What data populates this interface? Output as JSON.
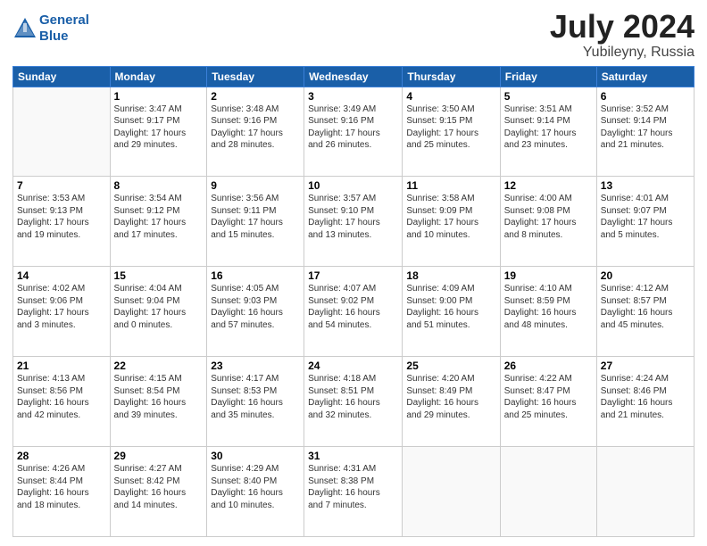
{
  "header": {
    "logo_line1": "General",
    "logo_line2": "Blue",
    "month": "July 2024",
    "location": "Yubileyny, Russia"
  },
  "weekdays": [
    "Sunday",
    "Monday",
    "Tuesday",
    "Wednesday",
    "Thursday",
    "Friday",
    "Saturday"
  ],
  "weeks": [
    [
      {
        "day": "",
        "info": ""
      },
      {
        "day": "1",
        "info": "Sunrise: 3:47 AM\nSunset: 9:17 PM\nDaylight: 17 hours\nand 29 minutes."
      },
      {
        "day": "2",
        "info": "Sunrise: 3:48 AM\nSunset: 9:16 PM\nDaylight: 17 hours\nand 28 minutes."
      },
      {
        "day": "3",
        "info": "Sunrise: 3:49 AM\nSunset: 9:16 PM\nDaylight: 17 hours\nand 26 minutes."
      },
      {
        "day": "4",
        "info": "Sunrise: 3:50 AM\nSunset: 9:15 PM\nDaylight: 17 hours\nand 25 minutes."
      },
      {
        "day": "5",
        "info": "Sunrise: 3:51 AM\nSunset: 9:14 PM\nDaylight: 17 hours\nand 23 minutes."
      },
      {
        "day": "6",
        "info": "Sunrise: 3:52 AM\nSunset: 9:14 PM\nDaylight: 17 hours\nand 21 minutes."
      }
    ],
    [
      {
        "day": "7",
        "info": "Sunrise: 3:53 AM\nSunset: 9:13 PM\nDaylight: 17 hours\nand 19 minutes."
      },
      {
        "day": "8",
        "info": "Sunrise: 3:54 AM\nSunset: 9:12 PM\nDaylight: 17 hours\nand 17 minutes."
      },
      {
        "day": "9",
        "info": "Sunrise: 3:56 AM\nSunset: 9:11 PM\nDaylight: 17 hours\nand 15 minutes."
      },
      {
        "day": "10",
        "info": "Sunrise: 3:57 AM\nSunset: 9:10 PM\nDaylight: 17 hours\nand 13 minutes."
      },
      {
        "day": "11",
        "info": "Sunrise: 3:58 AM\nSunset: 9:09 PM\nDaylight: 17 hours\nand 10 minutes."
      },
      {
        "day": "12",
        "info": "Sunrise: 4:00 AM\nSunset: 9:08 PM\nDaylight: 17 hours\nand 8 minutes."
      },
      {
        "day": "13",
        "info": "Sunrise: 4:01 AM\nSunset: 9:07 PM\nDaylight: 17 hours\nand 5 minutes."
      }
    ],
    [
      {
        "day": "14",
        "info": "Sunrise: 4:02 AM\nSunset: 9:06 PM\nDaylight: 17 hours\nand 3 minutes."
      },
      {
        "day": "15",
        "info": "Sunrise: 4:04 AM\nSunset: 9:04 PM\nDaylight: 17 hours\nand 0 minutes."
      },
      {
        "day": "16",
        "info": "Sunrise: 4:05 AM\nSunset: 9:03 PM\nDaylight: 16 hours\nand 57 minutes."
      },
      {
        "day": "17",
        "info": "Sunrise: 4:07 AM\nSunset: 9:02 PM\nDaylight: 16 hours\nand 54 minutes."
      },
      {
        "day": "18",
        "info": "Sunrise: 4:09 AM\nSunset: 9:00 PM\nDaylight: 16 hours\nand 51 minutes."
      },
      {
        "day": "19",
        "info": "Sunrise: 4:10 AM\nSunset: 8:59 PM\nDaylight: 16 hours\nand 48 minutes."
      },
      {
        "day": "20",
        "info": "Sunrise: 4:12 AM\nSunset: 8:57 PM\nDaylight: 16 hours\nand 45 minutes."
      }
    ],
    [
      {
        "day": "21",
        "info": "Sunrise: 4:13 AM\nSunset: 8:56 PM\nDaylight: 16 hours\nand 42 minutes."
      },
      {
        "day": "22",
        "info": "Sunrise: 4:15 AM\nSunset: 8:54 PM\nDaylight: 16 hours\nand 39 minutes."
      },
      {
        "day": "23",
        "info": "Sunrise: 4:17 AM\nSunset: 8:53 PM\nDaylight: 16 hours\nand 35 minutes."
      },
      {
        "day": "24",
        "info": "Sunrise: 4:18 AM\nSunset: 8:51 PM\nDaylight: 16 hours\nand 32 minutes."
      },
      {
        "day": "25",
        "info": "Sunrise: 4:20 AM\nSunset: 8:49 PM\nDaylight: 16 hours\nand 29 minutes."
      },
      {
        "day": "26",
        "info": "Sunrise: 4:22 AM\nSunset: 8:47 PM\nDaylight: 16 hours\nand 25 minutes."
      },
      {
        "day": "27",
        "info": "Sunrise: 4:24 AM\nSunset: 8:46 PM\nDaylight: 16 hours\nand 21 minutes."
      }
    ],
    [
      {
        "day": "28",
        "info": "Sunrise: 4:26 AM\nSunset: 8:44 PM\nDaylight: 16 hours\nand 18 minutes."
      },
      {
        "day": "29",
        "info": "Sunrise: 4:27 AM\nSunset: 8:42 PM\nDaylight: 16 hours\nand 14 minutes."
      },
      {
        "day": "30",
        "info": "Sunrise: 4:29 AM\nSunset: 8:40 PM\nDaylight: 16 hours\nand 10 minutes."
      },
      {
        "day": "31",
        "info": "Sunrise: 4:31 AM\nSunset: 8:38 PM\nDaylight: 16 hours\nand 7 minutes."
      },
      {
        "day": "",
        "info": ""
      },
      {
        "day": "",
        "info": ""
      },
      {
        "day": "",
        "info": ""
      }
    ]
  ]
}
